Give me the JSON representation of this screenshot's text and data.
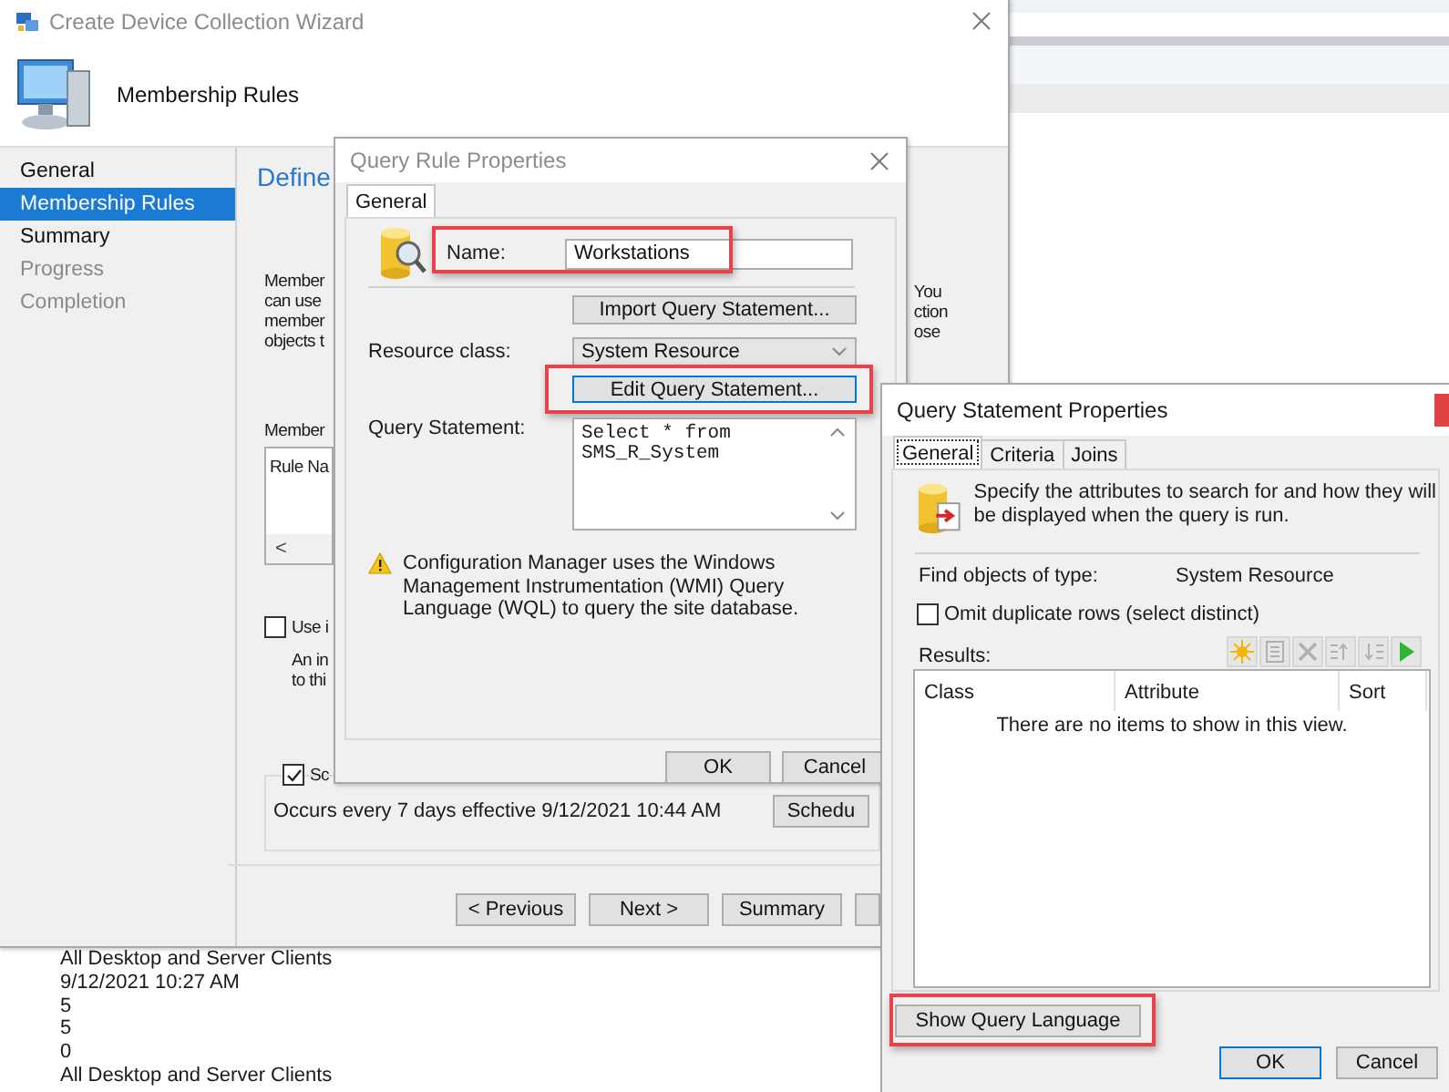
{
  "wizard": {
    "title": "Create Device Collection Wizard",
    "header": "Membership Rules",
    "nav": [
      {
        "label": "General",
        "selected": false,
        "disabled": false
      },
      {
        "label": "Membership Rules",
        "selected": true,
        "disabled": false
      },
      {
        "label": "Summary",
        "selected": false,
        "disabled": false
      },
      {
        "label": "Progress",
        "selected": false,
        "disabled": true
      },
      {
        "label": "Completion",
        "selected": false,
        "disabled": true
      }
    ],
    "heading": "Define",
    "intro_left": [
      "Member",
      "can use",
      "member",
      "objects t"
    ],
    "intro_right": [
      "You",
      "ction",
      "ose"
    ],
    "rules_label": "Member",
    "rules_column": "Rule Na",
    "scroll_left": "<",
    "incremental": {
      "label": "Use i",
      "checked": false,
      "lines": [
        "An in",
        "to thi"
      ]
    },
    "schedule": {
      "label": "Sc",
      "checked": true,
      "text": "Occurs every 7 days effective 9/12/2021 10:44 AM",
      "button": "Schedu"
    },
    "buttons": [
      "< Previous",
      "Next >",
      "Summary"
    ]
  },
  "details": [
    "All Desktop and Server Clients",
    "9/12/2021 10:27 AM",
    "5",
    "5",
    "0",
    "All Desktop and Server Clients"
  ],
  "query_rule": {
    "title": "Query Rule Properties",
    "tabs": [
      {
        "label": "General",
        "selected": true
      }
    ],
    "name_label": "Name:",
    "name_value": "Workstations",
    "name_highlighted": true,
    "import_button": "Import Query Statement...",
    "resource_label": "Resource class:",
    "resource_value": "System Resource",
    "edit_button": "Edit Query Statement...",
    "edit_focused": true,
    "edit_highlighted": true,
    "statement_label": "Query Statement:",
    "statement_lines": [
      "Select * from",
      "SMS_R_System"
    ],
    "warning": "Configuration Manager uses the Windows Management Instrumentation (WMI) Query Language (WQL) to query the site database.",
    "buttons": [
      "OK",
      "Cancel"
    ]
  },
  "query_statement": {
    "title": "Query Statement Properties",
    "tabs": [
      {
        "label": "General",
        "selected": true
      },
      {
        "label": "Criteria",
        "selected": false
      },
      {
        "label": "Joins",
        "selected": false
      }
    ],
    "description": "Specify the attributes to search for and how they will be displayed when the query is run.",
    "find_label": "Find objects of type:",
    "find_value": "System Resource",
    "omit_duplicates": {
      "label": "Omit duplicate rows (select distinct)",
      "checked": false
    },
    "results_label": "Results:",
    "toolbar": [
      {
        "kind": "new",
        "disabled": false
      },
      {
        "kind": "properties",
        "disabled": true
      },
      {
        "kind": "delete",
        "disabled": true
      },
      {
        "kind": "move_up",
        "disabled": true
      },
      {
        "kind": "move_down",
        "disabled": true
      },
      {
        "kind": "run",
        "disabled": false
      }
    ],
    "columns": [
      "Class",
      "Attribute",
      "Sort"
    ],
    "empty_message": "There are no items to show in this view.",
    "show_query_button": "Show Query Language",
    "show_query_highlighted": true,
    "buttons": [
      {
        "label": "OK",
        "default": true
      },
      {
        "label": "Cancel",
        "default": false
      }
    ]
  }
}
